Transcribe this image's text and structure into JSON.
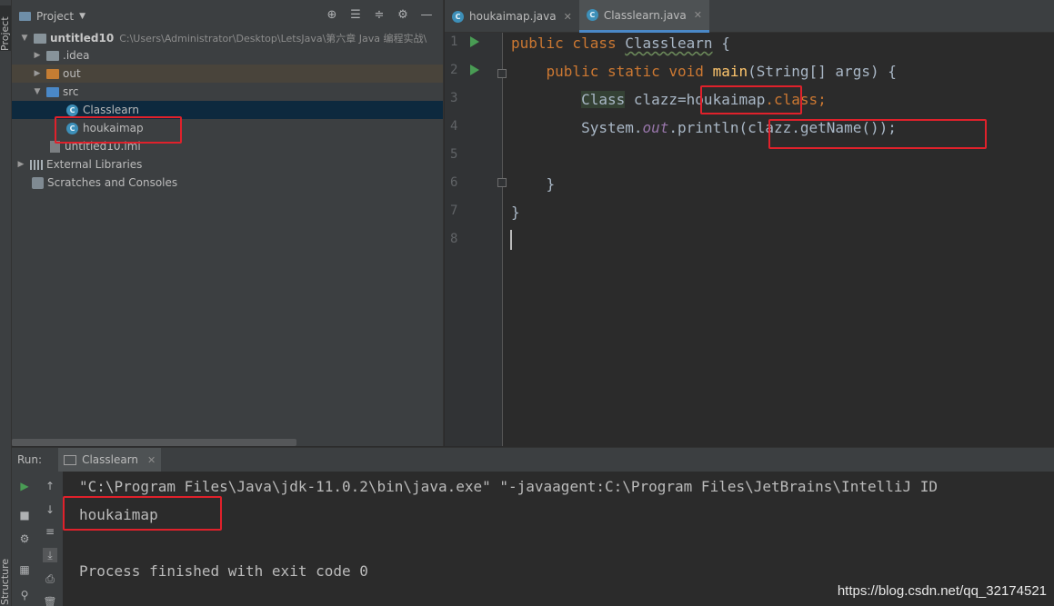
{
  "side_strip": {
    "project_tab": "Project",
    "structure_tab": "Structure"
  },
  "project_panel": {
    "title": "Project",
    "tree": [
      {
        "label": "untitled10",
        "path": "C:\\Users\\Administrator\\Desktop\\LetsJava\\第六章 Java 编程实战\\"
      },
      {
        "label": ".idea"
      },
      {
        "label": "out"
      },
      {
        "label": "src"
      },
      {
        "label": "Classlearn"
      },
      {
        "label": "houkaimap"
      },
      {
        "label": "untitled10.iml"
      },
      {
        "label": "External Libraries"
      },
      {
        "label": "Scratches and Consoles"
      }
    ]
  },
  "editor": {
    "tabs": [
      {
        "label": "houkaimap.java"
      },
      {
        "label": "Classlearn.java"
      }
    ],
    "line_numbers": [
      "1",
      "2",
      "3",
      "4",
      "5",
      "6",
      "7",
      "8"
    ],
    "code": {
      "l1_kw": "public class ",
      "l1_name": "Classlearn",
      "l1_rest": " {",
      "l2_indent": "    ",
      "l2_kw": "public static void ",
      "l2_fn": "main",
      "l2_rest": "(String[] args) {",
      "l3_indent": "        ",
      "l3_cls": "Class",
      "l3_mid": " clazz=houkaimap",
      "l3_kw": ".class;",
      "l4_indent": "        ",
      "l4_a": "System.",
      "l4_fld": "out",
      "l4_b": ".println(clazz.getName());",
      "l6": "    }",
      "l7": "}"
    }
  },
  "run_panel": {
    "label": "Run:",
    "tab": "Classlearn",
    "console": [
      "\"C:\\Program Files\\Java\\jdk-11.0.2\\bin\\java.exe\" \"-javaagent:C:\\Program Files\\JetBrains\\IntelliJ ID",
      "houkaimap",
      "",
      "Process finished with exit code 0"
    ]
  },
  "watermark": "https://blog.csdn.net/qq_32174521",
  "colors": {
    "annotation": "#e0212b",
    "keyword": "#cc7832",
    "method": "#ffc66d",
    "field": "#9876aa"
  }
}
